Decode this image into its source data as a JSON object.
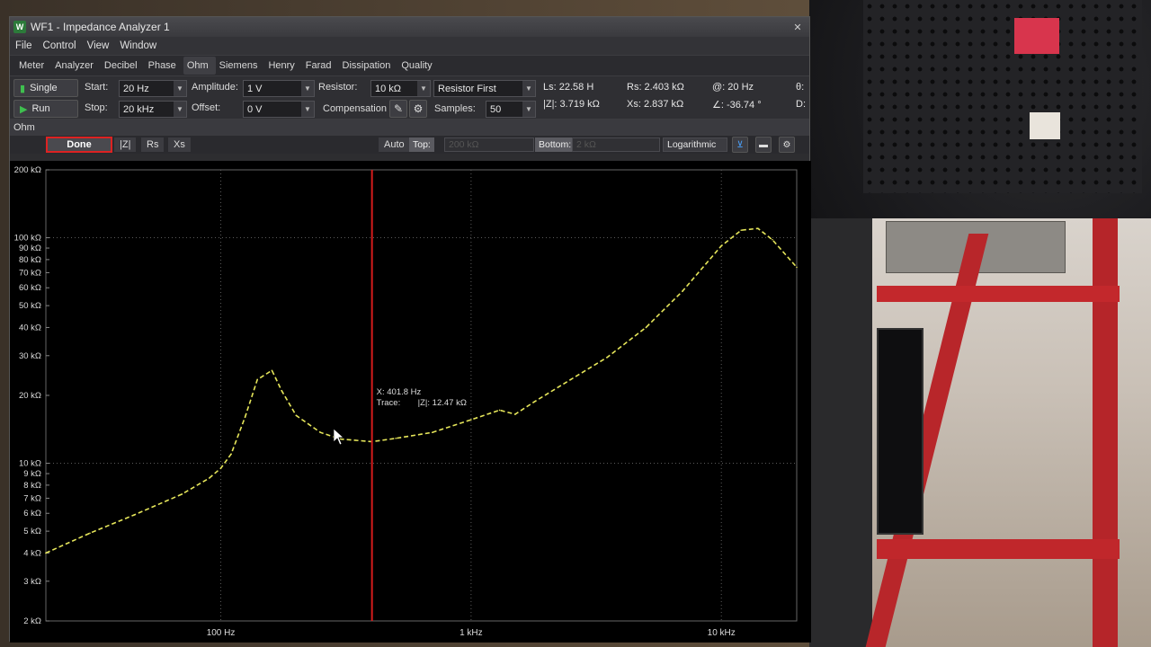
{
  "window": {
    "app_icon_text": "W",
    "title": "WF1 - Impedance Analyzer 1",
    "close_glyph": "✕"
  },
  "menu": [
    "File",
    "Control",
    "View",
    "Window"
  ],
  "views": [
    "Meter",
    "Analyzer",
    "Decibel",
    "Phase",
    "Ohm",
    "Siemens",
    "Henry",
    "Farad",
    "Dissipation",
    "Quality"
  ],
  "active_view": "Ohm",
  "controls": {
    "single_label": "Single",
    "run_label": "Run",
    "start_label": "Start:",
    "start_value": "20 Hz",
    "stop_label": "Stop:",
    "stop_value": "20 kHz",
    "amplitude_label": "Amplitude:",
    "amplitude_value": "1 V",
    "offset_label": "Offset:",
    "offset_value": "0 V",
    "resistor_label": "Resistor:",
    "resistor_value": "10 kΩ",
    "resistor_mode": "Resistor First",
    "compensation_label": "Compensation",
    "samples_label": "Samples:",
    "samples_value": "50"
  },
  "readouts": {
    "ls": "Ls: 22.58 H",
    "rs": "Rs: 2.403 kΩ",
    "freq": "@: 20 Hz",
    "extra1": "θ:",
    "z": "|Z|: 3.719 kΩ",
    "xs": "Xs: 2.837 kΩ",
    "angle": "∠: -36.74 °",
    "extra2": "D:"
  },
  "panel": {
    "title": "Ohm"
  },
  "plotbar": {
    "done_label": "Done",
    "traces": [
      "|Z|",
      "Rs",
      "Xs"
    ],
    "auto_label": "Auto",
    "top_label": "Top:",
    "top_value": "200 kΩ",
    "bottom_label": "Bottom:",
    "bottom_value": "2 kΩ",
    "scale": "Logarithmic"
  },
  "colors": {
    "trace": "#e6e65a",
    "cursor": "#d41c1c",
    "grid": "#5a5a5a"
  },
  "chart_data": {
    "type": "line",
    "x_scale": "log",
    "y_scale": "log",
    "xlim": [
      20,
      20000
    ],
    "ylim": [
      2000,
      200000
    ],
    "x_ticks": [
      {
        "value": 100,
        "label": "100 Hz"
      },
      {
        "value": 1000,
        "label": "1 kHz"
      },
      {
        "value": 10000,
        "label": "10 kHz"
      }
    ],
    "y_ticks": [
      {
        "value": 200000,
        "label": "200 kΩ"
      },
      {
        "value": 100000,
        "label": "100 kΩ"
      },
      {
        "value": 90000,
        "label": "90 kΩ"
      },
      {
        "value": 80000,
        "label": "80 kΩ"
      },
      {
        "value": 70000,
        "label": "70 kΩ"
      },
      {
        "value": 60000,
        "label": "60 kΩ"
      },
      {
        "value": 50000,
        "label": "50 kΩ"
      },
      {
        "value": 40000,
        "label": "40 kΩ"
      },
      {
        "value": 30000,
        "label": "30 kΩ"
      },
      {
        "value": 20000,
        "label": "20 kΩ"
      },
      {
        "value": 10000,
        "label": "10 kΩ"
      },
      {
        "value": 9000,
        "label": "9 kΩ"
      },
      {
        "value": 8000,
        "label": "8 kΩ"
      },
      {
        "value": 7000,
        "label": "7 kΩ"
      },
      {
        "value": 6000,
        "label": "6 kΩ"
      },
      {
        "value": 5000,
        "label": "5 kΩ"
      },
      {
        "value": 4000,
        "label": "4 kΩ"
      },
      {
        "value": 3000,
        "label": "3 kΩ"
      },
      {
        "value": 2000,
        "label": "2 kΩ"
      }
    ],
    "series": [
      {
        "x": [
          20,
          30,
          45,
          70,
          90,
          100,
          110,
          125,
          140,
          160,
          175,
          200,
          250,
          300,
          402,
          500,
          700,
          1000,
          1300,
          1500,
          1800,
          2500,
          3500,
          5000,
          7000,
          10000,
          12000,
          14000,
          16000,
          20000
        ],
        "y": [
          4000,
          4900,
          5900,
          7300,
          8600,
          9500,
          11000,
          16000,
          23500,
          25800,
          21000,
          16300,
          13700,
          12800,
          12470,
          12900,
          13700,
          15600,
          17200,
          16500,
          18800,
          23500,
          29500,
          40000,
          58000,
          92000,
          108000,
          110000,
          98000,
          74000
        ]
      }
    ],
    "cursor": {
      "x": 401.8,
      "x_text": "X: 401.8 Hz",
      "trace_label": "Trace:",
      "trace_text": "|Z|: 12.47 kΩ"
    }
  }
}
